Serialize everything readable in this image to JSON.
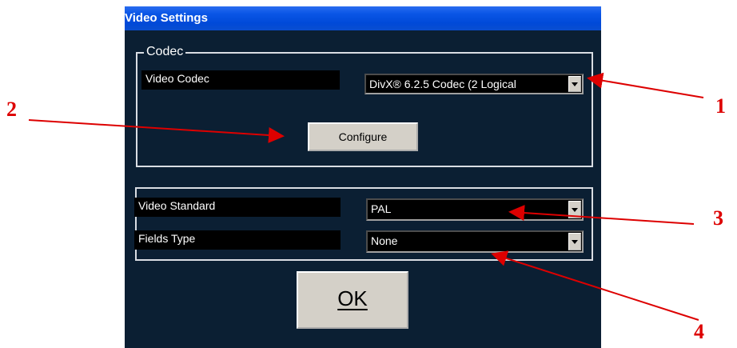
{
  "window": {
    "title": "Video Settings",
    "background": "#0b1f33"
  },
  "codec_group": {
    "legend": "Codec",
    "video_codec_label": "Video Codec",
    "video_codec_value": "DivX® 6.2.5 Codec (2 Logical",
    "configure_label": "Configure"
  },
  "standard_group": {
    "video_standard_label": "Video Standard",
    "video_standard_value": "PAL",
    "fields_type_label": "Fields Type",
    "fields_type_value": "None"
  },
  "ok_button": {
    "label": "OK",
    "mnemonic": "O"
  },
  "annotations": {
    "color": "#dd0000",
    "markers": [
      "1",
      "2",
      "3",
      "4"
    ]
  }
}
